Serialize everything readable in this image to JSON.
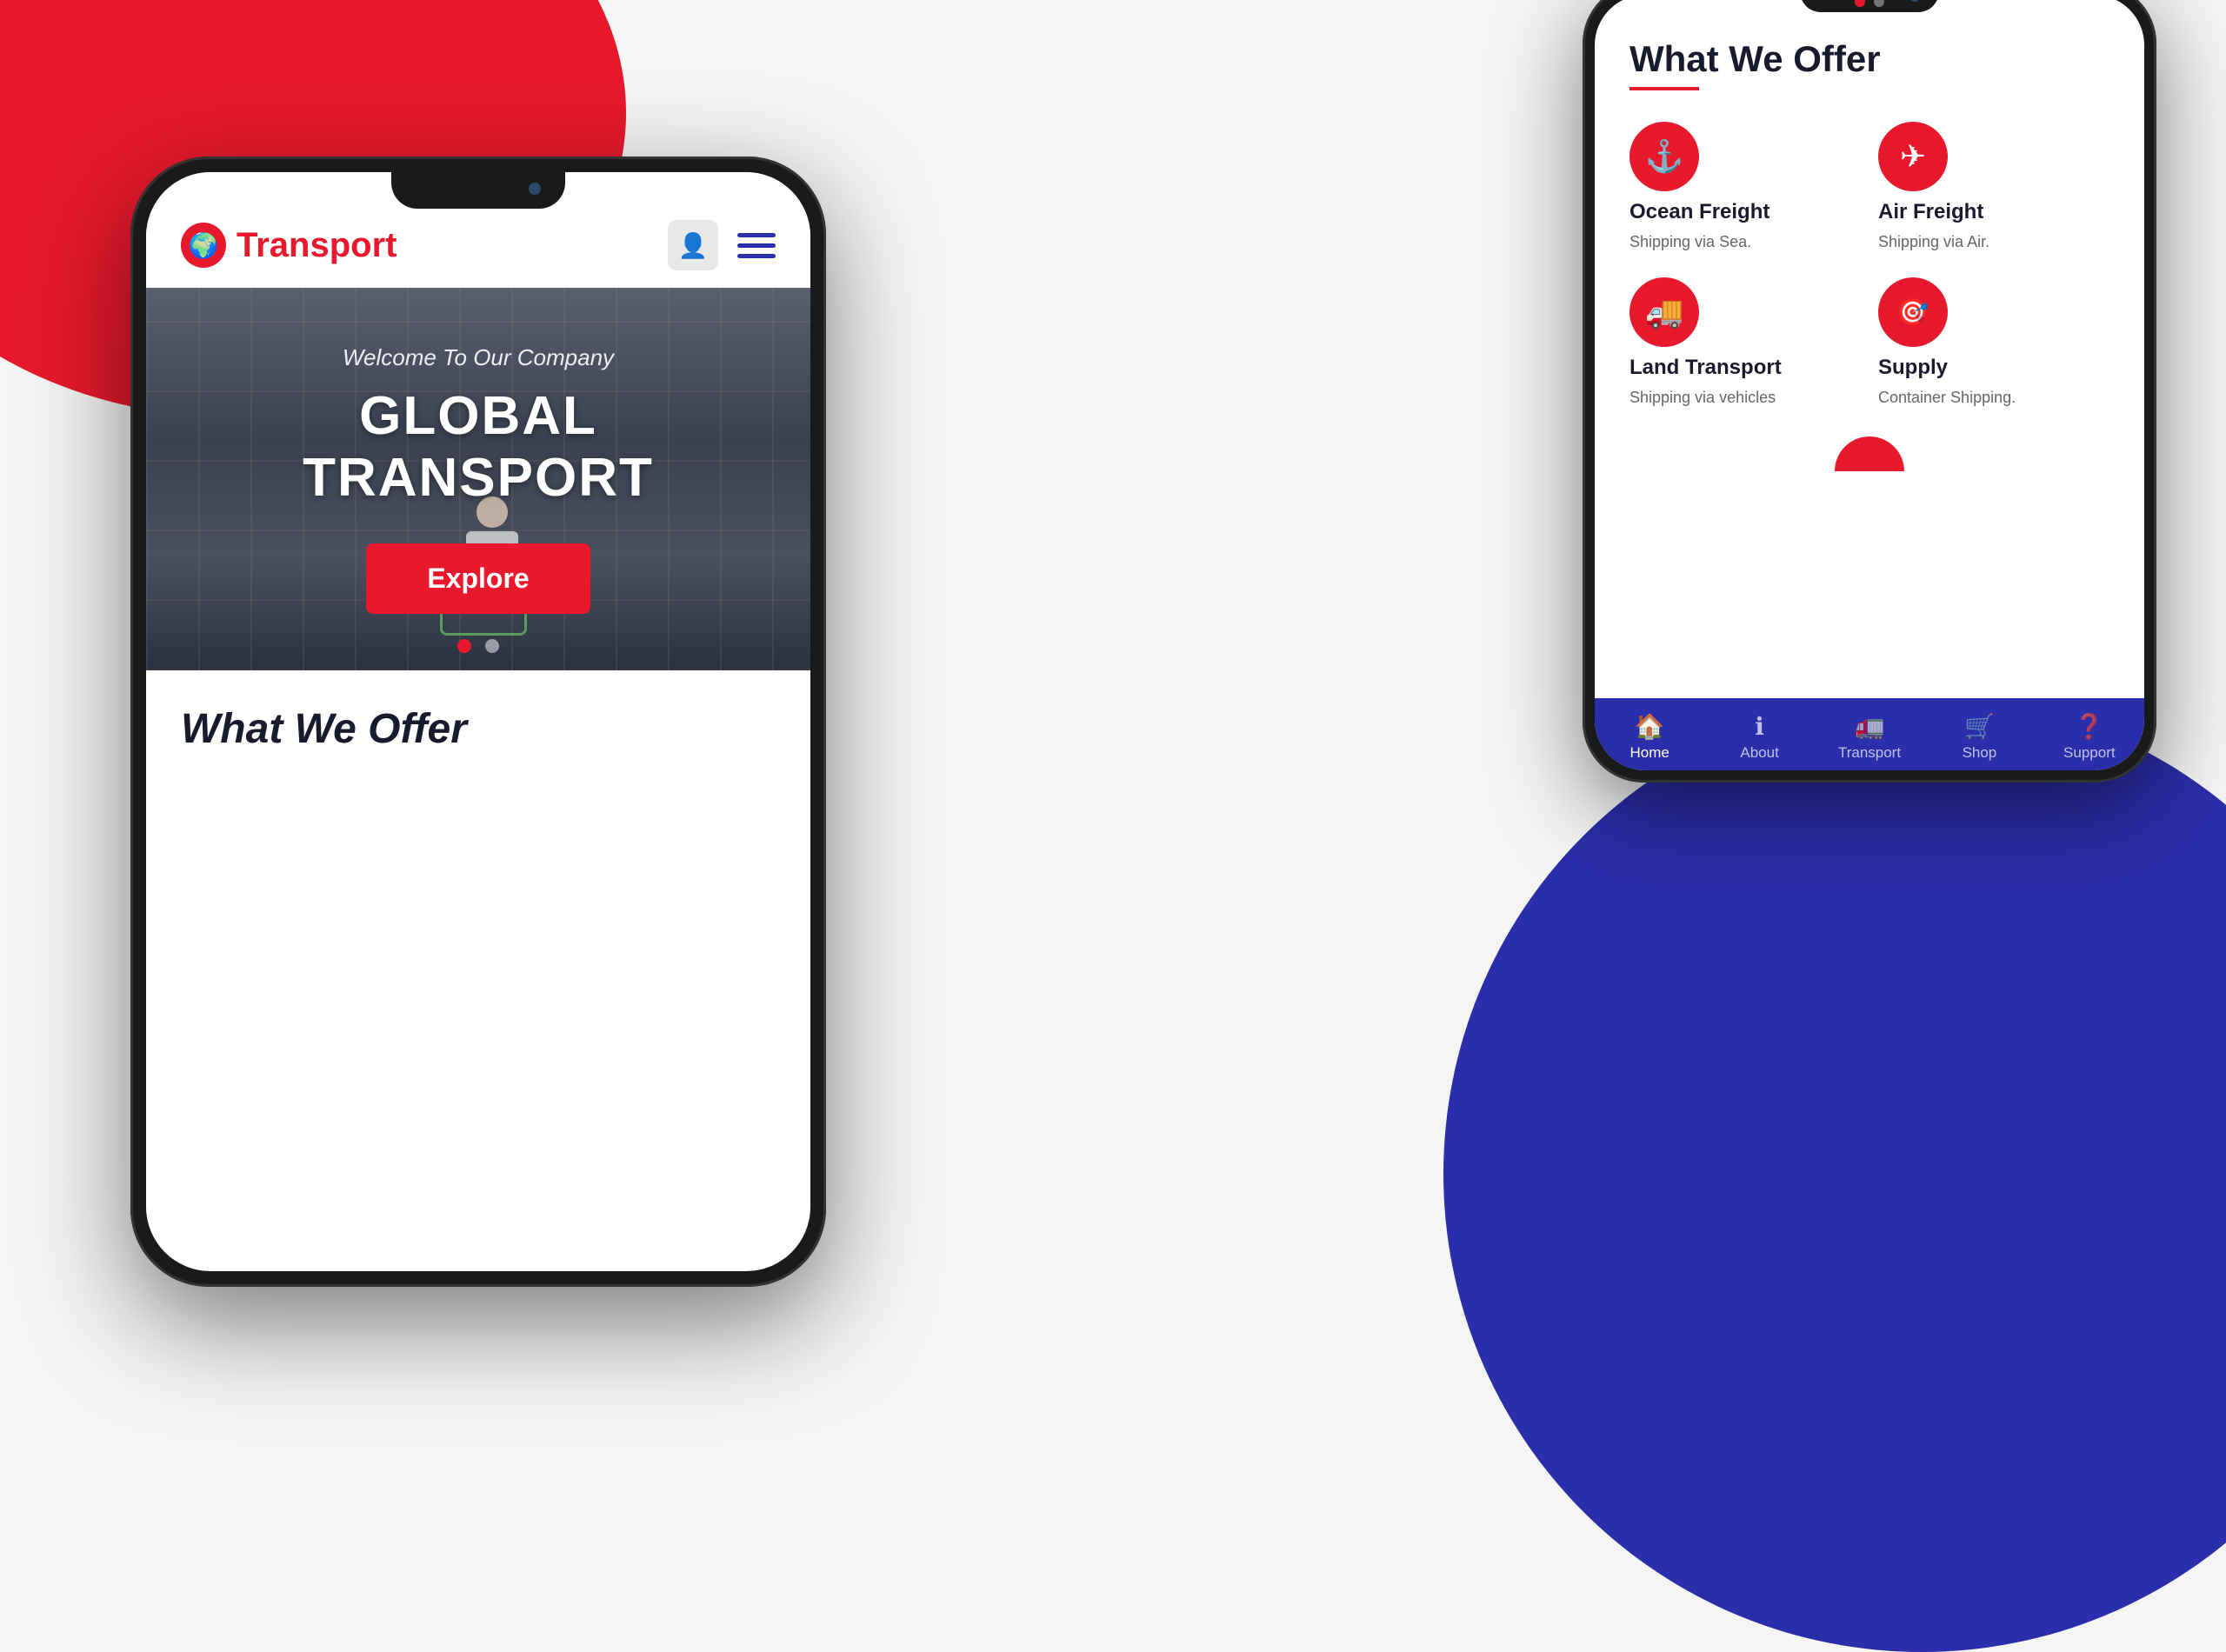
{
  "background": {
    "red_circle": "decorative top-left red circle",
    "blue_circle": "decorative bottom-right blue circle"
  },
  "phone_left": {
    "header": {
      "logo_text": "Transport",
      "logo_globe_icon": "🌍"
    },
    "hero": {
      "subtitle": "Welcome To Our Company",
      "title": "GLOBAL TRANSPORT",
      "explore_button": "Explore",
      "dots": [
        {
          "active": true
        },
        {
          "active": false
        }
      ]
    },
    "offer_section": {
      "title": "What We Offer"
    }
  },
  "phone_right": {
    "carousel": {
      "dots": [
        {
          "active": true
        },
        {
          "active": false
        }
      ]
    },
    "content": {
      "title": "What We Offer",
      "services": [
        {
          "name": "Ocean Freight",
          "description": "Shipping via Sea.",
          "icon": "⚓"
        },
        {
          "name": "Air Freight",
          "description": "Shipping via Air.",
          "icon": "✈"
        },
        {
          "name": "Land Transport",
          "description": "Shipping via vehicles",
          "icon": "🚚"
        },
        {
          "name": "Supply",
          "description": "Container Shipping.",
          "icon": "⊕"
        }
      ]
    },
    "nav": {
      "items": [
        {
          "label": "Home",
          "icon": "🏠",
          "active": true
        },
        {
          "label": "About",
          "icon": "ℹ",
          "active": false
        },
        {
          "label": "Transport",
          "icon": "🚛",
          "active": false
        },
        {
          "label": "Shop",
          "icon": "🛒",
          "active": false
        },
        {
          "label": "Support",
          "icon": "❓",
          "active": false
        }
      ]
    }
  }
}
